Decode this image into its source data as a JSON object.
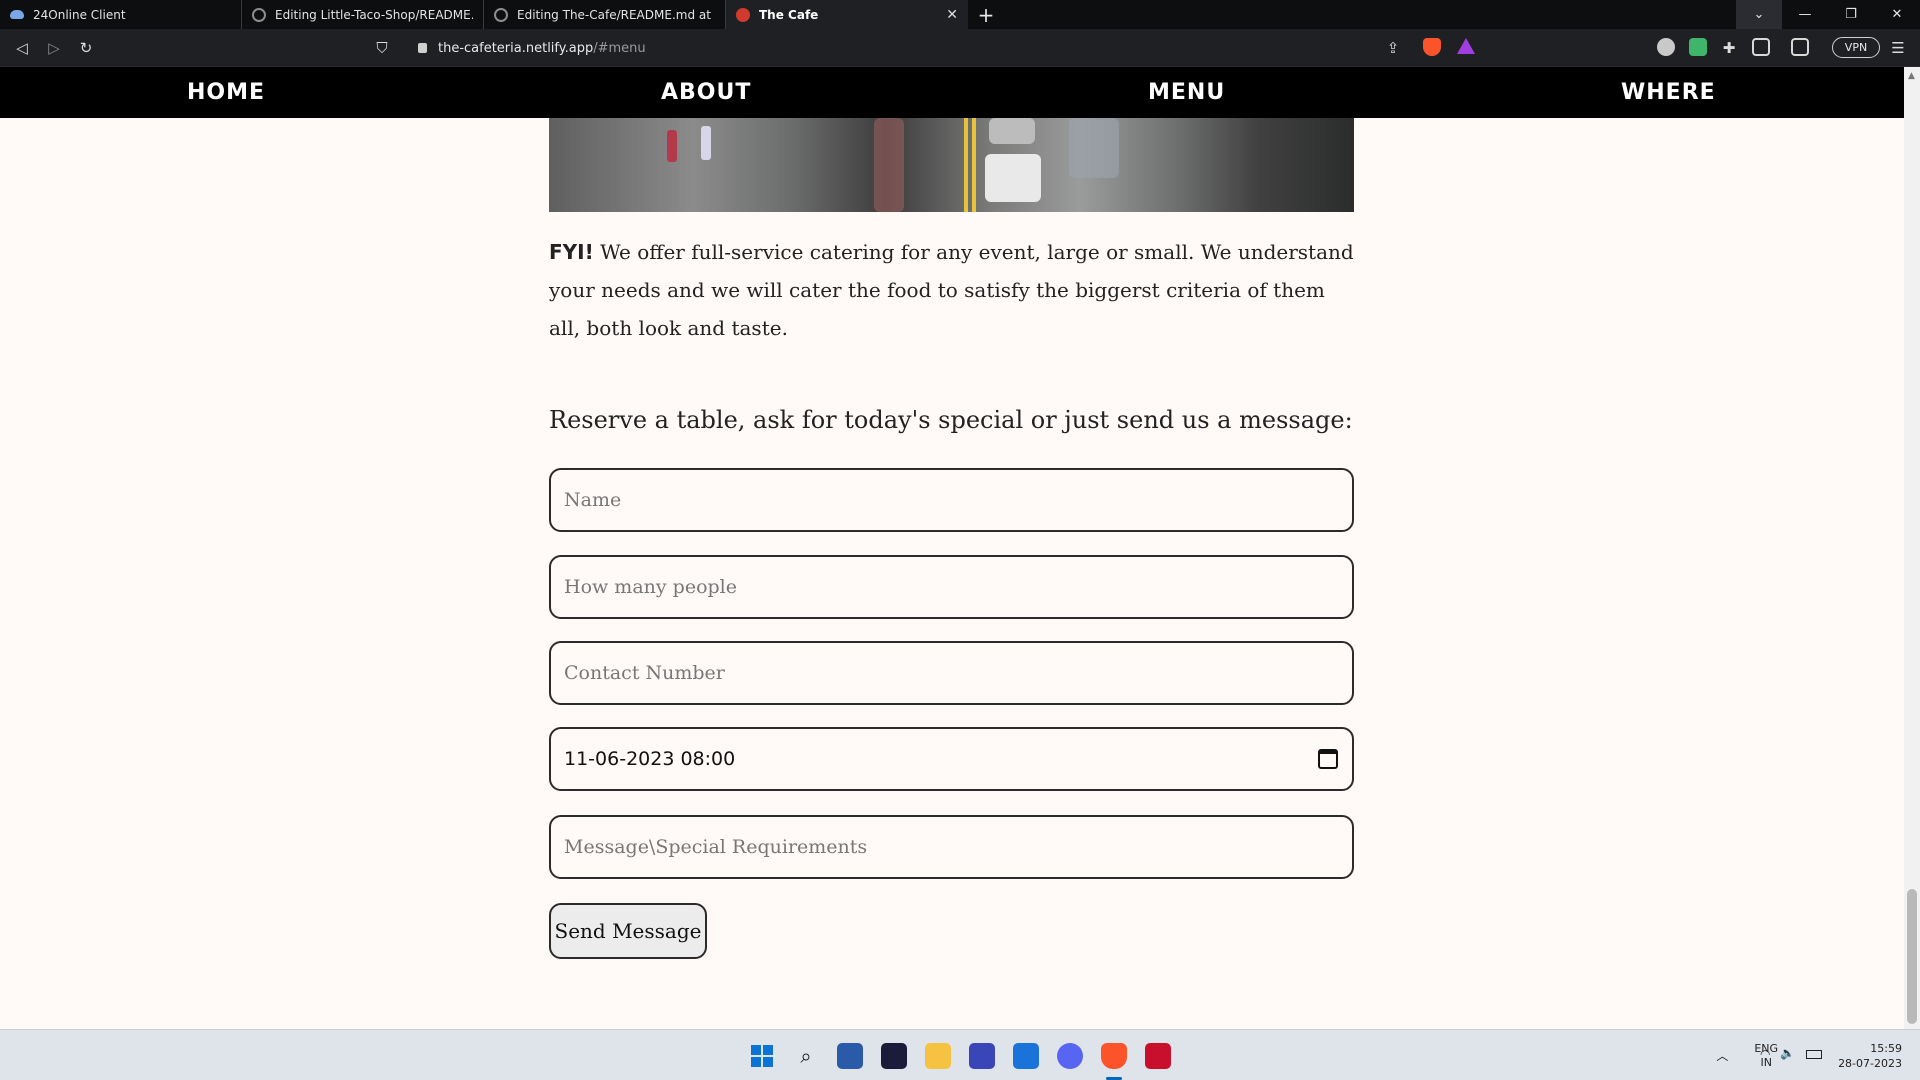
{
  "tabs": [
    {
      "title": "24Online Client",
      "icon": "cloud-icon",
      "active": false
    },
    {
      "title": "Editing Little-Taco-Shop/README.md",
      "icon": "github-icon",
      "active": false
    },
    {
      "title": "Editing The-Cafe/README.md at main",
      "icon": "github-icon",
      "active": false
    },
    {
      "title": "The Cafe",
      "icon": "cafe-icon",
      "active": true
    }
  ],
  "new_tab_label": "+",
  "address_bar": {
    "host": "the-cafeteria.netlify.app",
    "path": "/#menu"
  },
  "vpn_label": "VPN",
  "nav": {
    "home": "HOME",
    "about": "ABOUT",
    "menu": "MENU",
    "where": "WHERE"
  },
  "fyi": {
    "label": "FYI!",
    "text": " We offer full-service catering for any event, large or small. We understand your needs and we will cater the food to satisfy the biggerst criteria of them all, both look and taste."
  },
  "form": {
    "heading": "Reserve a table, ask for today's special or just send us a message:",
    "name_placeholder": "Name",
    "people_placeholder": "How many people",
    "contact_placeholder": "Contact Number",
    "datetime_value": "11-06-2023 08:00",
    "message_placeholder": "Message\\Special Requirements",
    "send_label": "Send Message"
  },
  "tray": {
    "lang_line1": "ENG",
    "lang_line2": "IN",
    "time": "15:59",
    "date": "28-07-2023"
  },
  "colors": {
    "nav_bg": "#000000",
    "page_bg": "#fffaf8",
    "accent_brave": "#fb542b"
  }
}
